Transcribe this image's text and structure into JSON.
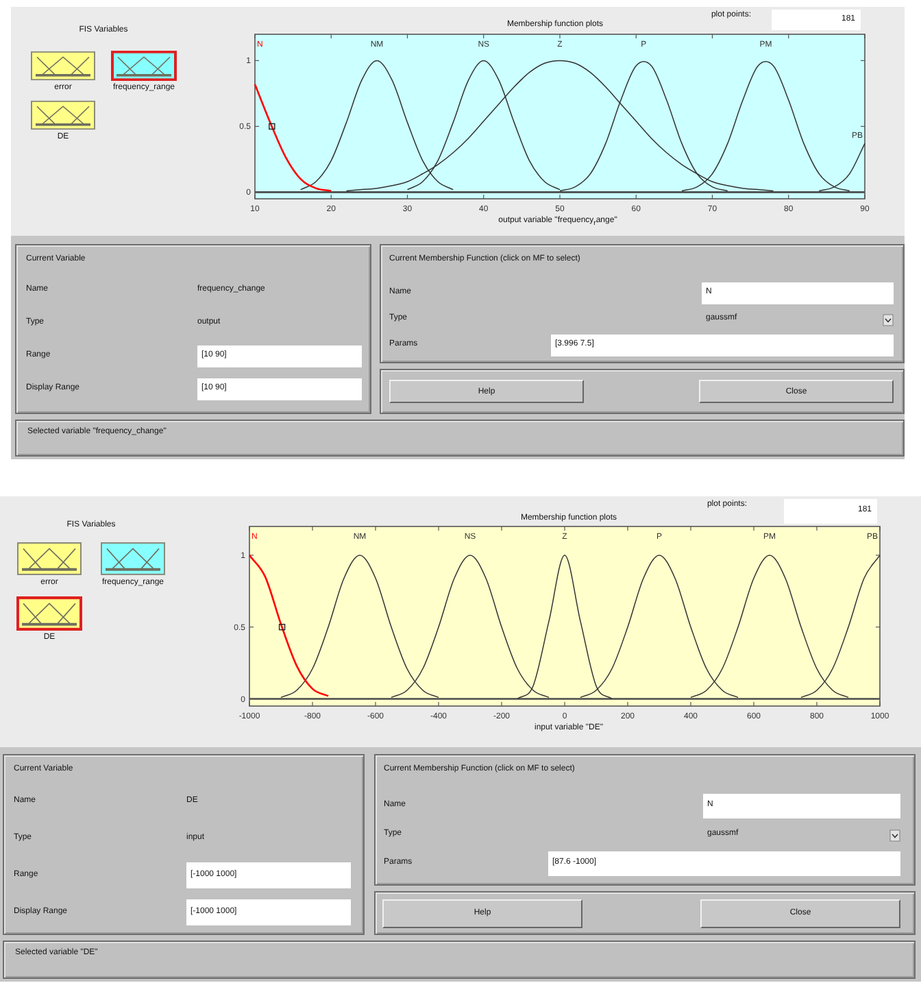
{
  "editors": [
    {
      "fis_variables": {
        "title": "FIS Variables",
        "items": [
          {
            "name": "error",
            "kind": "input",
            "selected": false
          },
          {
            "name": "frequency_range",
            "kind": "output",
            "selected": true
          },
          {
            "name": "DE",
            "kind": "input",
            "selected": false
          }
        ]
      },
      "plot": {
        "plot_points_label": "plot points:",
        "plot_points": "181",
        "chart_data": {
          "type": "line",
          "title": "Membership function plots",
          "xlabel": "output variable \"frequency$_{r}$ange\"",
          "xlim": [
            10,
            90
          ],
          "ylim": [
            -0.05,
            1.2
          ],
          "xticks": [
            10,
            20,
            30,
            40,
            50,
            60,
            70,
            80,
            90
          ],
          "yticks": [
            0,
            0.5,
            1
          ],
          "x": [
            10,
            12,
            14,
            16,
            18,
            20,
            22,
            24,
            26,
            28,
            30,
            32,
            34,
            36,
            38,
            40,
            42,
            44,
            46,
            48,
            50,
            52,
            54,
            56,
            58,
            60,
            62,
            64,
            66,
            68,
            70,
            72,
            74,
            76,
            78,
            80,
            82,
            84,
            86,
            88,
            90
          ],
          "series": [
            {
              "name": "N",
              "color": "#ff0000",
              "values": [
                0.82,
                0.53,
                0.27,
                0.1,
                0.03,
                0.01,
                null,
                null,
                null,
                null,
                null,
                null,
                null,
                null,
                null,
                null,
                null,
                null,
                null,
                null,
                null,
                null,
                null,
                null,
                null,
                null,
                null,
                null,
                null,
                null,
                null,
                null,
                null,
                null,
                null,
                null,
                null,
                null,
                null,
                null,
                null
              ]
            },
            {
              "name": "NM",
              "color": "#333333",
              "values": [
                null,
                null,
                null,
                0.02,
                0.08,
                0.24,
                0.53,
                0.85,
                1,
                0.85,
                0.53,
                0.24,
                0.08,
                0.02,
                null,
                null,
                null,
                null,
                null,
                null,
                null,
                null,
                null,
                null,
                null,
                null,
                null,
                null,
                null,
                null,
                null,
                null,
                null,
                null,
                null,
                null,
                null,
                null,
                null,
                null,
                null
              ]
            },
            {
              "name": "NS",
              "color": "#333333",
              "values": [
                null,
                null,
                null,
                null,
                null,
                null,
                null,
                null,
                null,
                null,
                0.02,
                0.08,
                0.24,
                0.53,
                0.85,
                1,
                0.85,
                0.53,
                0.24,
                0.08,
                0.02,
                null,
                null,
                null,
                null,
                null,
                null,
                null,
                null,
                null,
                null,
                null,
                null,
                null,
                null,
                null,
                null,
                null,
                null,
                null,
                null
              ]
            },
            {
              "name": "Z",
              "color": "#333333",
              "values": [
                null,
                null,
                null,
                null,
                null,
                null,
                0.01,
                0.02,
                0.03,
                0.05,
                0.08,
                0.14,
                0.21,
                0.3,
                0.41,
                0.54,
                0.67,
                0.8,
                0.91,
                0.98,
                1,
                0.98,
                0.91,
                0.8,
                0.67,
                0.54,
                0.41,
                0.3,
                0.21,
                0.14,
                0.08,
                0.05,
                0.03,
                0.02,
                0.01,
                null,
                null,
                null,
                null,
                null,
                null
              ]
            },
            {
              "name": "P",
              "color": "#333333",
              "values": [
                null,
                null,
                null,
                null,
                null,
                null,
                null,
                null,
                null,
                null,
                null,
                null,
                null,
                null,
                null,
                null,
                null,
                null,
                null,
                null,
                0.01,
                0.04,
                0.14,
                0.37,
                0.7,
                0.96,
                0.96,
                0.7,
                0.37,
                0.14,
                0.04,
                0.01,
                null,
                null,
                null,
                null,
                null,
                null,
                null,
                null,
                null
              ]
            },
            {
              "name": "PM",
              "color": "#333333",
              "values": [
                null,
                null,
                null,
                null,
                null,
                null,
                null,
                null,
                null,
                null,
                null,
                null,
                null,
                null,
                null,
                null,
                null,
                null,
                null,
                null,
                null,
                null,
                null,
                null,
                null,
                null,
                null,
                null,
                0.01,
                0.04,
                0.14,
                0.37,
                0.7,
                0.96,
                0.96,
                0.7,
                0.37,
                0.14,
                0.04,
                0.01,
                null
              ]
            },
            {
              "name": "PB",
              "color": "#333333",
              "values": [
                null,
                null,
                null,
                null,
                null,
                null,
                null,
                null,
                null,
                null,
                null,
                null,
                null,
                null,
                null,
                null,
                null,
                null,
                null,
                null,
                null,
                null,
                null,
                null,
                null,
                null,
                null,
                null,
                null,
                null,
                null,
                null,
                null,
                null,
                null,
                null,
                null,
                0.01,
                0.04,
                0.14,
                0.37
              ]
            }
          ]
        }
      },
      "current_variable": {
        "title": "Current Variable",
        "name_label": "Name",
        "name": "frequency_change",
        "type_label": "Type",
        "type": "output",
        "range_label": "Range",
        "range": "[10 90]",
        "display_range_label": "Display Range",
        "display_range": "[10 90]"
      },
      "current_mf": {
        "title": "Current Membership Function (click on MF to select)",
        "name_label": "Name",
        "name": "N",
        "type_label": "Type",
        "type": "gaussmf",
        "params_label": "Params",
        "params": "[3.996 7.5]"
      },
      "buttons": [
        "Help",
        "Close"
      ],
      "status": "Selected variable \"frequency_change\""
    },
    {
      "fis_variables": {
        "title": "FIS Variables",
        "items": [
          {
            "name": "error",
            "kind": "input",
            "selected": false
          },
          {
            "name": "frequency_range",
            "kind": "output",
            "selected": false
          },
          {
            "name": "DE",
            "kind": "input",
            "selected": true
          }
        ]
      },
      "plot": {
        "plot_points_label": "plot points:",
        "plot_points": "181",
        "chart_data": {
          "type": "line",
          "title": "Membership function plots",
          "xlabel": "input variable \"DE\"",
          "xlim": [
            -1000,
            1000
          ],
          "ylim": [
            -0.05,
            1.2
          ],
          "xticks": [
            -1000,
            -800,
            -600,
            -400,
            -200,
            0,
            200,
            400,
            600,
            800,
            1000
          ],
          "yticks": [
            0,
            0.5,
            1
          ],
          "x": [
            -1000,
            -950,
            -900,
            -850,
            -800,
            -750,
            -700,
            -650,
            -600,
            -550,
            -500,
            -450,
            -400,
            -350,
            -300,
            -250,
            -200,
            -150,
            -100,
            -50,
            0,
            50,
            100,
            150,
            200,
            250,
            300,
            350,
            400,
            450,
            500,
            550,
            600,
            650,
            700,
            750,
            800,
            850,
            900,
            950,
            1000
          ],
          "series": [
            {
              "name": "N",
              "color": "#ff0000",
              "values": [
                1,
                0.85,
                0.52,
                0.23,
                0.07,
                0.02,
                null,
                null,
                null,
                null,
                null,
                null,
                null,
                null,
                null,
                null,
                null,
                null,
                null,
                null,
                null,
                null,
                null,
                null,
                null,
                null,
                null,
                null,
                null,
                null,
                null,
                null,
                null,
                null,
                null,
                null,
                null,
                null,
                null,
                null,
                null
              ]
            },
            {
              "name": "NM",
              "color": "#333333",
              "values": [
                null,
                null,
                0.01,
                0.06,
                0.21,
                0.5,
                0.84,
                1,
                0.84,
                0.5,
                0.21,
                0.06,
                0.01,
                null,
                null,
                null,
                null,
                null,
                null,
                null,
                null,
                null,
                null,
                null,
                null,
                null,
                null,
                null,
                null,
                null,
                null,
                null,
                null,
                null,
                null,
                null,
                null,
                null,
                null,
                null,
                null
              ]
            },
            {
              "name": "NS",
              "color": "#333333",
              "values": [
                null,
                null,
                null,
                null,
                null,
                null,
                null,
                null,
                null,
                0.01,
                0.06,
                0.21,
                0.5,
                0.84,
                1,
                0.84,
                0.5,
                0.21,
                0.06,
                0.01,
                null,
                null,
                null,
                null,
                null,
                null,
                null,
                null,
                null,
                null,
                null,
                null,
                null,
                null,
                null,
                null,
                null,
                null,
                null,
                null,
                null
              ]
            },
            {
              "name": "Z",
              "color": "#333333",
              "values": [
                null,
                null,
                null,
                null,
                null,
                null,
                null,
                null,
                null,
                null,
                null,
                null,
                null,
                null,
                null,
                null,
                null,
                0,
                0.09,
                0.54,
                1,
                0.54,
                0.09,
                0,
                null,
                null,
                null,
                null,
                null,
                null,
                null,
                null,
                null,
                null,
                null,
                null,
                null,
                null,
                null,
                null,
                null
              ]
            },
            {
              "name": "P",
              "color": "#333333",
              "values": [
                null,
                null,
                null,
                null,
                null,
                null,
                null,
                null,
                null,
                null,
                null,
                null,
                null,
                null,
                null,
                null,
                null,
                null,
                null,
                null,
                null,
                0.01,
                0.06,
                0.21,
                0.5,
                0.84,
                1,
                0.84,
                0.5,
                0.21,
                0.06,
                0.01,
                null,
                null,
                null,
                null,
                null,
                null,
                null,
                null,
                null
              ]
            },
            {
              "name": "PM",
              "color": "#333333",
              "values": [
                null,
                null,
                null,
                null,
                null,
                null,
                null,
                null,
                null,
                null,
                null,
                null,
                null,
                null,
                null,
                null,
                null,
                null,
                null,
                null,
                null,
                null,
                null,
                null,
                null,
                null,
                null,
                null,
                0.01,
                0.06,
                0.21,
                0.5,
                0.84,
                1,
                0.84,
                0.5,
                0.21,
                0.06,
                0.01,
                null,
                null
              ]
            },
            {
              "name": "PB",
              "color": "#333333",
              "values": [
                null,
                null,
                null,
                null,
                null,
                null,
                null,
                null,
                null,
                null,
                null,
                null,
                null,
                null,
                null,
                null,
                null,
                null,
                null,
                null,
                null,
                null,
                null,
                null,
                null,
                null,
                null,
                null,
                null,
                null,
                null,
                null,
                null,
                null,
                null,
                0.01,
                0.06,
                0.21,
                0.5,
                0.84,
                1
              ]
            }
          ]
        }
      },
      "current_variable": {
        "title": "Current Variable",
        "name_label": "Name",
        "name": "DE",
        "type_label": "Type",
        "type": "input",
        "range_label": "Range",
        "range": "[-1000 1000]",
        "display_range_label": "Display Range",
        "display_range": "[-1000 1000]"
      },
      "current_mf": {
        "title": "Current Membership Function (click on MF to select)",
        "name_label": "Name",
        "name": "N",
        "type_label": "Type",
        "type": "gaussmf",
        "params_label": "Params",
        "params": "[87.6 -1000]"
      },
      "buttons": [
        "Help",
        "Close"
      ],
      "status": "Selected variable \"DE\""
    }
  ]
}
